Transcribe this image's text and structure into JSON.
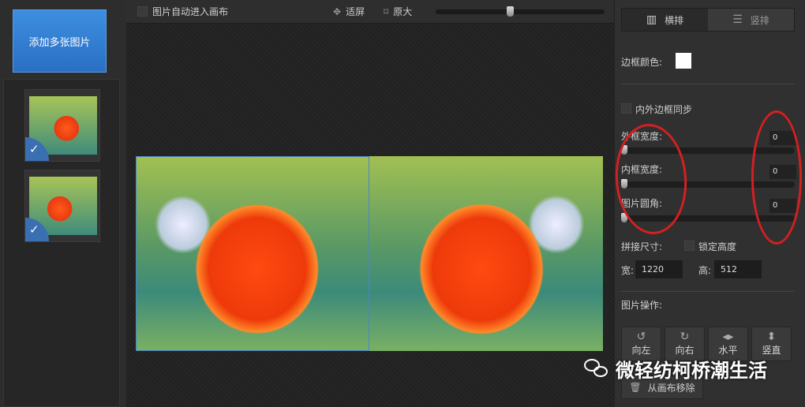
{
  "left": {
    "add_button": "添加多张图片",
    "thumbs": [
      {
        "checked": true
      },
      {
        "checked": true
      }
    ]
  },
  "toolbar": {
    "auto_canvas": "图片自动进入画布",
    "fit": "适屏",
    "original": "原大",
    "zoom_fraction": 0.45
  },
  "right": {
    "layout_tabs": [
      {
        "label": "横排",
        "active": true
      },
      {
        "label": "竖排",
        "active": false
      }
    ],
    "border_color_label": "边框颜色:",
    "border_color": "#ffffff",
    "sync_label": "内外边框同步",
    "outer_label": "外框宽度:",
    "outer_value": "0",
    "inner_label": "内框宽度:",
    "inner_value": "0",
    "corner_label": "图片圆角:",
    "corner_value": "0",
    "size_label": "拼接尺寸:",
    "lock_label": "锁定高度",
    "width_label": "宽:",
    "width_value": "1220",
    "height_label": "高:",
    "height_value": "512",
    "ops_label": "图片操作:",
    "ops": [
      "向左",
      "向右",
      "水平",
      "竖直"
    ],
    "remove": "从画布移除"
  },
  "watermark": "微轻纺柯桥潮生活"
}
